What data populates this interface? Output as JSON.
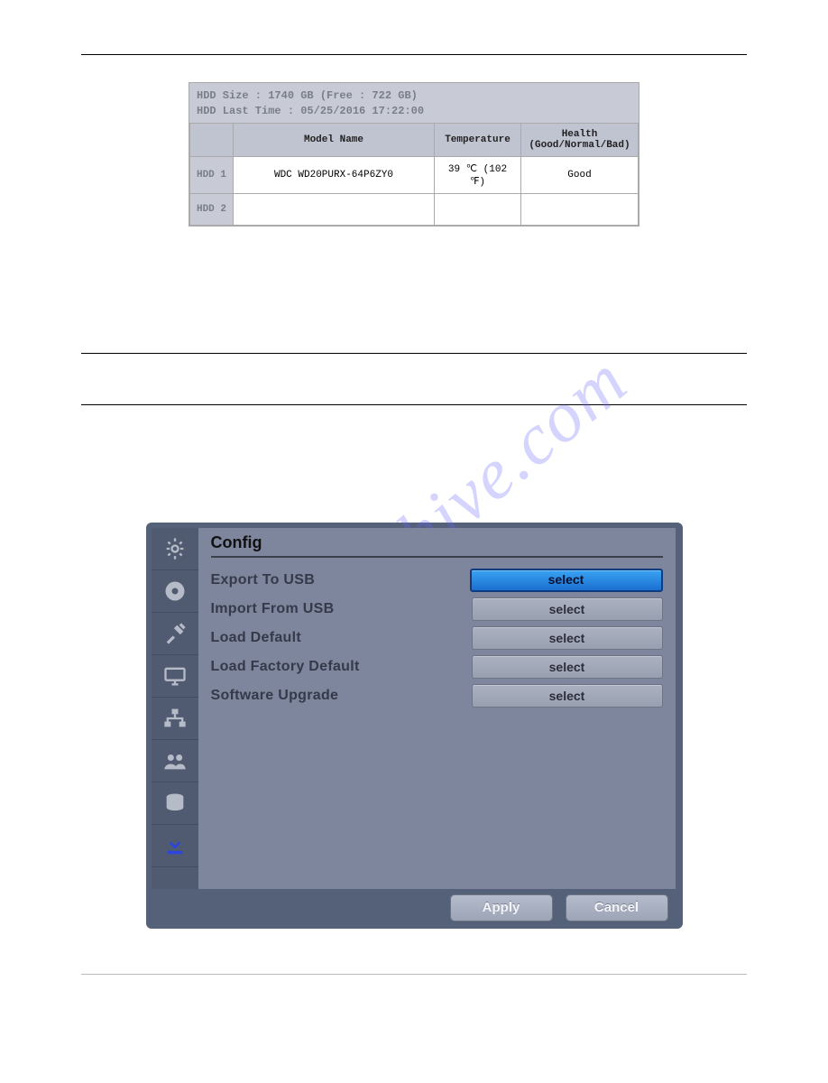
{
  "watermark": "manualshive.com",
  "hdd": {
    "size_line": "HDD Size : 1740 GB (Free : 722 GB)",
    "lasttime_line": "HDD Last Time : 05/25/2016 17:22:00",
    "headers": {
      "model": "Model Name",
      "temp": "Temperature",
      "health": "Health",
      "health_sub": "(Good/Normal/Bad)"
    },
    "rows": [
      {
        "label": "HDD 1",
        "model": "WDC WD20PURX-64P6ZY0",
        "temp": "39 ℃ (102 ℉)",
        "health": "Good"
      },
      {
        "label": "HDD 2",
        "model": "",
        "temp": "",
        "health": ""
      }
    ]
  },
  "config": {
    "title": "Config",
    "items": [
      {
        "label": "Export To USB",
        "btn": "select",
        "selected": true
      },
      {
        "label": "Import From USB",
        "btn": "select",
        "selected": false
      },
      {
        "label": "Load Default",
        "btn": "select",
        "selected": false
      },
      {
        "label": "Load Factory Default",
        "btn": "select",
        "selected": false
      },
      {
        "label": "Software Upgrade",
        "btn": "select",
        "selected": false
      }
    ],
    "apply": "Apply",
    "cancel": "Cancel"
  }
}
